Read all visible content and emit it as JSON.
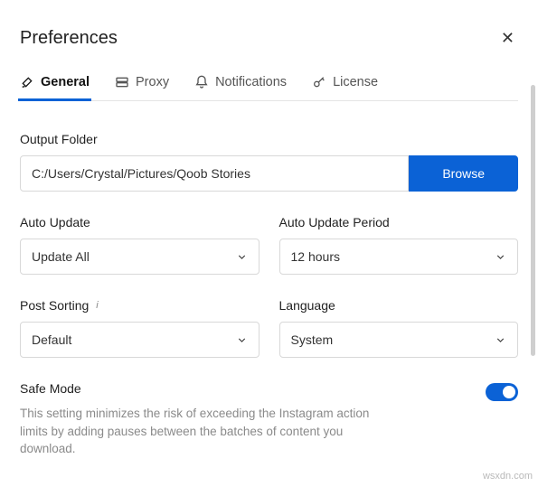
{
  "title": "Preferences",
  "tabs": {
    "general": "General",
    "proxy": "Proxy",
    "notifications": "Notifications",
    "license": "License"
  },
  "outputFolder": {
    "label": "Output Folder",
    "value": "C:/Users/Crystal/Pictures/Qoob Stories",
    "button": "Browse"
  },
  "autoUpdate": {
    "label": "Auto Update",
    "value": "Update All"
  },
  "autoUpdatePeriod": {
    "label": "Auto Update Period",
    "value": "12 hours"
  },
  "postSorting": {
    "label": "Post Sorting",
    "value": "Default"
  },
  "language": {
    "label": "Language",
    "value": "System"
  },
  "safeMode": {
    "label": "Safe Mode",
    "description": "This setting minimizes the risk of exceeding the Instagram action limits by adding pauses between the batches of content you download.",
    "enabled": true
  },
  "watermark": "wsxdn.com"
}
